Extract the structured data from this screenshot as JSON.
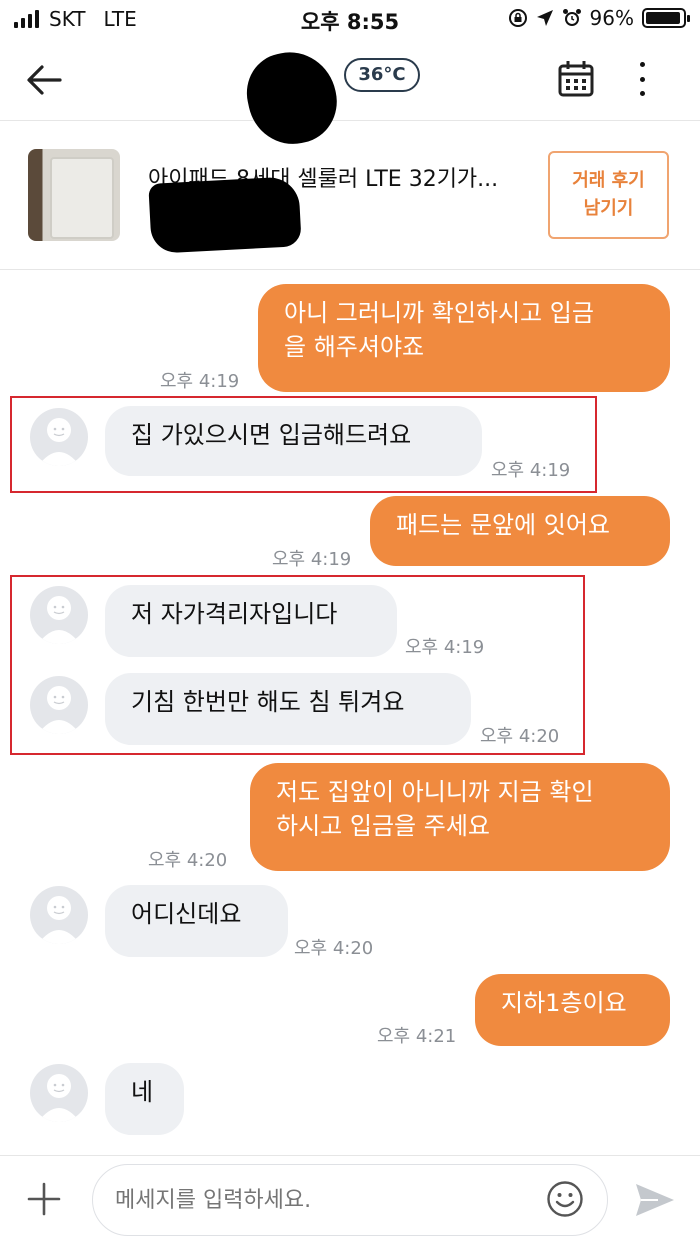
{
  "status_bar": {
    "carrier": "SKT",
    "network": "LTE",
    "time": "오후 8:55",
    "battery": "96%"
  },
  "header": {
    "temperature": "36°C",
    "back_icon": "back-arrow-icon",
    "calendar_icon": "calendar-icon",
    "more_icon": "more-vertical-icon"
  },
  "product": {
    "title": "아이패드 8세대 셀룰러 LTE 32기가...",
    "review_button_line1": "거래 후기",
    "review_button_line2": "남기기"
  },
  "messages": [
    {
      "sender": "me",
      "line1": "아니 그러니까 확인하시고 입금",
      "line2": "을 해주셔야죠",
      "time": "오후 4:19"
    },
    {
      "sender": "them",
      "text": "집 가있으시면 입금해드려요",
      "time": "오후 4:19"
    },
    {
      "sender": "me",
      "text": "패드는 문앞에 잇어요",
      "time": "오후 4:19"
    },
    {
      "sender": "them",
      "text": "저 자가격리자입니다",
      "time": "오후 4:19"
    },
    {
      "sender": "them",
      "text": "기침 한번만 해도 침 튀겨요",
      "time": "오후 4:20"
    },
    {
      "sender": "me",
      "line1": "저도 집앞이 아니니까 지금 확인",
      "line2": "하시고 입금을 주세요",
      "time": "오후 4:20"
    },
    {
      "sender": "them",
      "text": "어디신데요",
      "time": "오후 4:20"
    },
    {
      "sender": "me",
      "text": "지하1층이요",
      "time": "오후 4:21"
    },
    {
      "sender": "them",
      "text": "네"
    }
  ],
  "composer": {
    "placeholder": "메세지를 입력하세요.",
    "plus_icon": "plus-icon",
    "emoji_icon": "emoji-icon",
    "send_icon": "send-icon"
  },
  "colors": {
    "accent": "#f08a3f",
    "highlight_box": "#d6282f",
    "bubble_other": "#eef0f3"
  }
}
